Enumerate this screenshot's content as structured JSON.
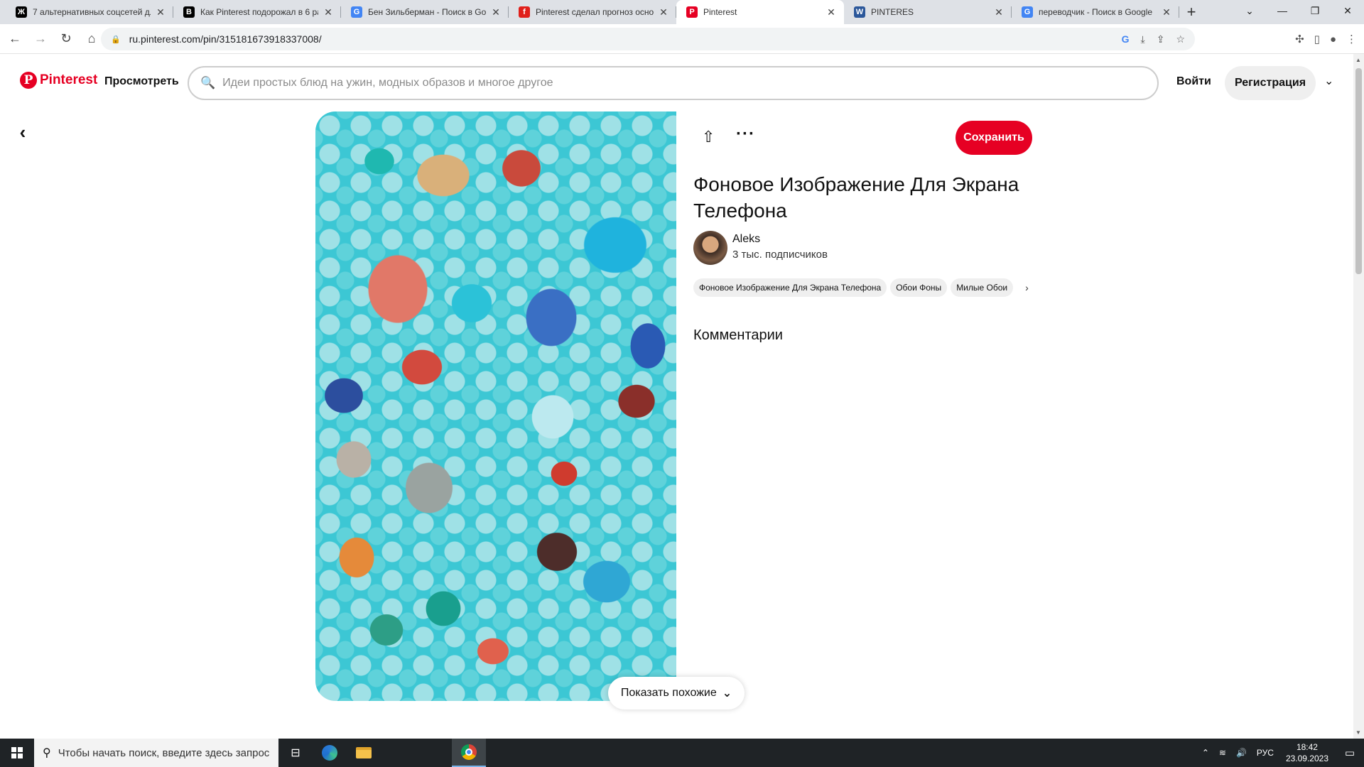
{
  "browser": {
    "tabs": [
      {
        "title": "7 альтернативных соцсетей для",
        "favicon": "Ж",
        "color": "#000000"
      },
      {
        "title": "Как Pinterest подорожал в 6 раз",
        "favicon": "B",
        "color": "#000000"
      },
      {
        "title": "Бен Зильберман - Поиск в Goo",
        "favicon": "G",
        "color": "#4285f4"
      },
      {
        "title": "Pinterest сделал прогноз осно",
        "favicon": "f",
        "color": "#e0201b"
      },
      {
        "title": "Pinterest",
        "favicon": "P",
        "color": "#e60023",
        "active": true
      },
      {
        "title": "PINTERES",
        "favicon": "W",
        "color": "#2b579a"
      },
      {
        "title": "переводчик - Поиск в Google",
        "favicon": "G",
        "color": "#4285f4"
      }
    ],
    "url": "ru.pinterest.com/pin/315181673918337008/"
  },
  "header": {
    "logo_text": "Pinterest",
    "browse_label": "Просмотреть",
    "search_placeholder": "Идеи простых блюд на ужин, модных образов и многое другое",
    "login_label": "Войти",
    "signup_label": "Регистрация"
  },
  "pin": {
    "save_label": "Сохранить",
    "title": "Фоновое Изображение Для Экрана Телефона",
    "author_name": "Aleks",
    "followers": "3 тыс. подписчиков",
    "tags": [
      "Фоновое Изображение Для Экрана Телефона",
      "Обои Фоны",
      "Милые Обои"
    ],
    "comments_heading": "Комментарии",
    "show_similar_label": "Показать похожие"
  },
  "taskbar": {
    "search_placeholder": "Чтобы начать поиск, введите здесь запрос",
    "language": "РУС",
    "time": "18:42",
    "date": "23.09.2023"
  }
}
